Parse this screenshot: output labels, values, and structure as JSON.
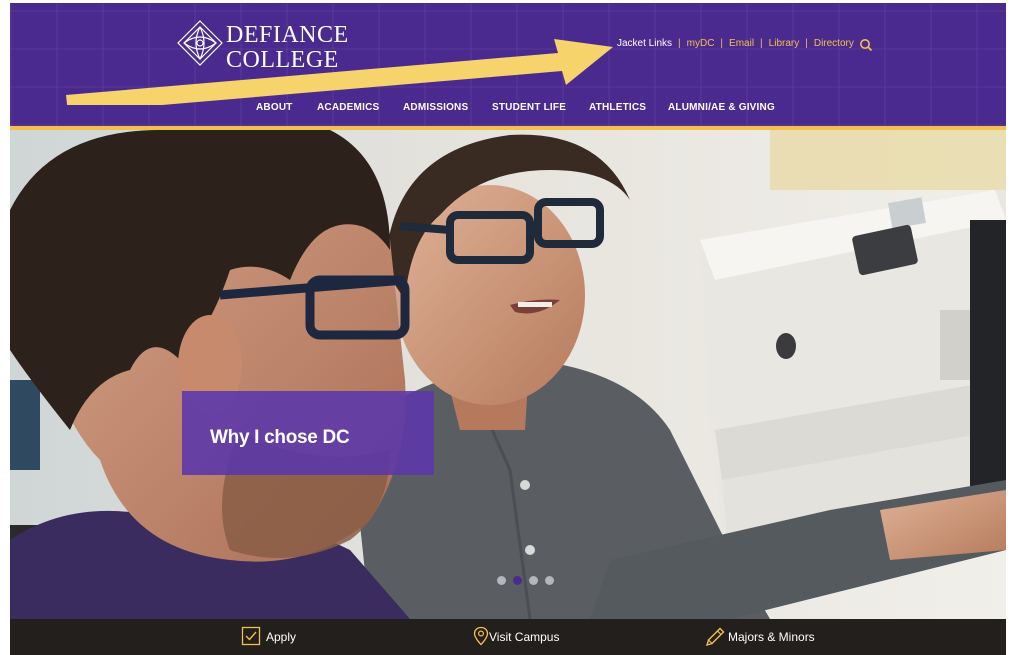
{
  "brand": {
    "line1": "DEFIANCE",
    "line2": "COLLEGE"
  },
  "utility_links": [
    {
      "label": "Jacket Links"
    },
    {
      "label": "myDC"
    },
    {
      "label": "Email"
    },
    {
      "label": "Library"
    },
    {
      "label": "Directory"
    }
  ],
  "utility_separator": "|",
  "main_nav": [
    {
      "label": "ABOUT"
    },
    {
      "label": "ACADEMICS"
    },
    {
      "label": "ADMISSIONS"
    },
    {
      "label": "STUDENT LIFE"
    },
    {
      "label": "ATHLETICS"
    },
    {
      "label": "ALUMNI/AE & GIVING"
    }
  ],
  "hero": {
    "caption": "Why I chose DC",
    "slides_total": 4,
    "active_slide": 2
  },
  "footer_actions": [
    {
      "label": "Apply",
      "icon": "check-box-icon"
    },
    {
      "label": "Visit Campus",
      "icon": "map-pin-icon"
    },
    {
      "label": "Majors & Minors",
      "icon": "pencil-icon"
    }
  ],
  "colors": {
    "brand_purple": "#4b2a8f",
    "accent_gold": "#f2c04b",
    "footer_dark": "#231f1c",
    "arrow_yellow": "#f6d36b"
  }
}
